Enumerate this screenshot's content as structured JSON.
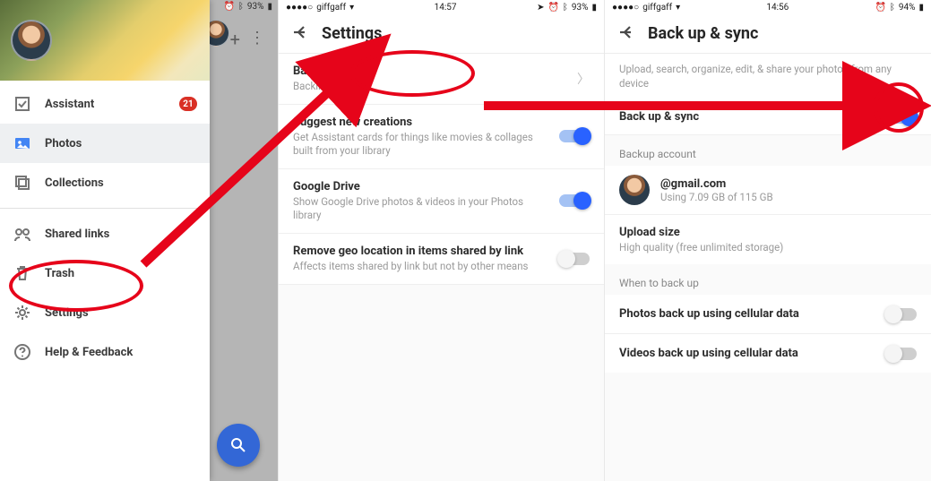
{
  "panel1": {
    "status": {
      "battery": "93%"
    },
    "nav": [
      {
        "icon": "assistant-icon",
        "label": "Assistant",
        "badge": "21"
      },
      {
        "icon": "photos-icon",
        "label": "Photos",
        "selected": true
      },
      {
        "icon": "collections-icon",
        "label": "Collections"
      }
    ],
    "nav2": [
      {
        "icon": "shared-links-icon",
        "label": "Shared links"
      },
      {
        "icon": "trash-icon",
        "label": "Trash"
      },
      {
        "icon": "settings-icon",
        "label": "Settings"
      },
      {
        "icon": "help-icon",
        "label": "Help & Feedback"
      }
    ]
  },
  "panel2": {
    "status": {
      "carrier": "giffgaff",
      "time": "14:57",
      "battery": "93%"
    },
    "title": "Settings",
    "rows": [
      {
        "label": "Back up & sync",
        "sub": "Backing up tc",
        "action": "chevron"
      },
      {
        "label": "Suggest new creations",
        "sub": "Get Assistant cards for things like movies & collages built from your library",
        "action": "toggle-on"
      },
      {
        "label": "Google Drive",
        "sub": "Show Google Drive photos & videos in your Photos library",
        "action": "toggle-on"
      },
      {
        "label": "Remove geo location in items shared by link",
        "sub": "Affects items shared by link but not by other means",
        "action": "toggle-off"
      }
    ]
  },
  "panel3": {
    "status": {
      "carrier": "giffgaff",
      "time": "14:56",
      "battery": "94%"
    },
    "title": "Back up & sync",
    "desc": "Upload, search, organize, edit, & share your photos from any device",
    "master_toggle": {
      "label": "Back up & sync",
      "on": true
    },
    "sections": {
      "backup_account_head": "Backup account",
      "account_email": "@gmail.com",
      "account_storage": "Using 7.09 GB of 115 GB",
      "upload_size_label": "Upload size",
      "upload_size_sub": "High quality (free unlimited storage)",
      "when_head": "When to back up",
      "photos_cellular": "Photos back up using cellular data",
      "videos_cellular": "Videos back up using cellular data"
    }
  }
}
